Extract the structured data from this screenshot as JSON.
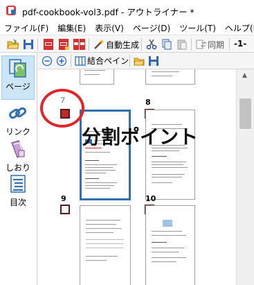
{
  "window": {
    "title": "pdf-cookbook-vol3.pdf - アウトライナー *"
  },
  "menu": {
    "items": [
      {
        "label": "ファイル(F)"
      },
      {
        "label": "編集(E)"
      },
      {
        "label": "表示(V)"
      },
      {
        "label": "ページ(D)"
      },
      {
        "label": "ツール(T)"
      },
      {
        "label": "ヘルプ(H)"
      }
    ]
  },
  "toolbar": {
    "auto_generate_label": "自動生成",
    "sync_label": "同期",
    "page_indicator": "-1-"
  },
  "subtoolbar": {
    "merge_pane_label": "結合ペイン"
  },
  "nav": {
    "items": [
      {
        "label": "ページ"
      },
      {
        "label": "リンク"
      },
      {
        "label": "しおり"
      },
      {
        "label": "目次"
      }
    ]
  },
  "thumbnails": {
    "pages": [
      {
        "number": "7",
        "checked": true
      },
      {
        "number": "8",
        "checked": false
      },
      {
        "number": "9",
        "checked": false
      },
      {
        "number": "10",
        "checked": false
      }
    ]
  },
  "annotation": {
    "split_point_text": "分割ポイント",
    "highlight_color": "#e0262a"
  },
  "colors": {
    "selection_border": "#2f6fb3",
    "checkbox_checked": "#c0282c",
    "nav_active_bg": "#cde6f7"
  }
}
